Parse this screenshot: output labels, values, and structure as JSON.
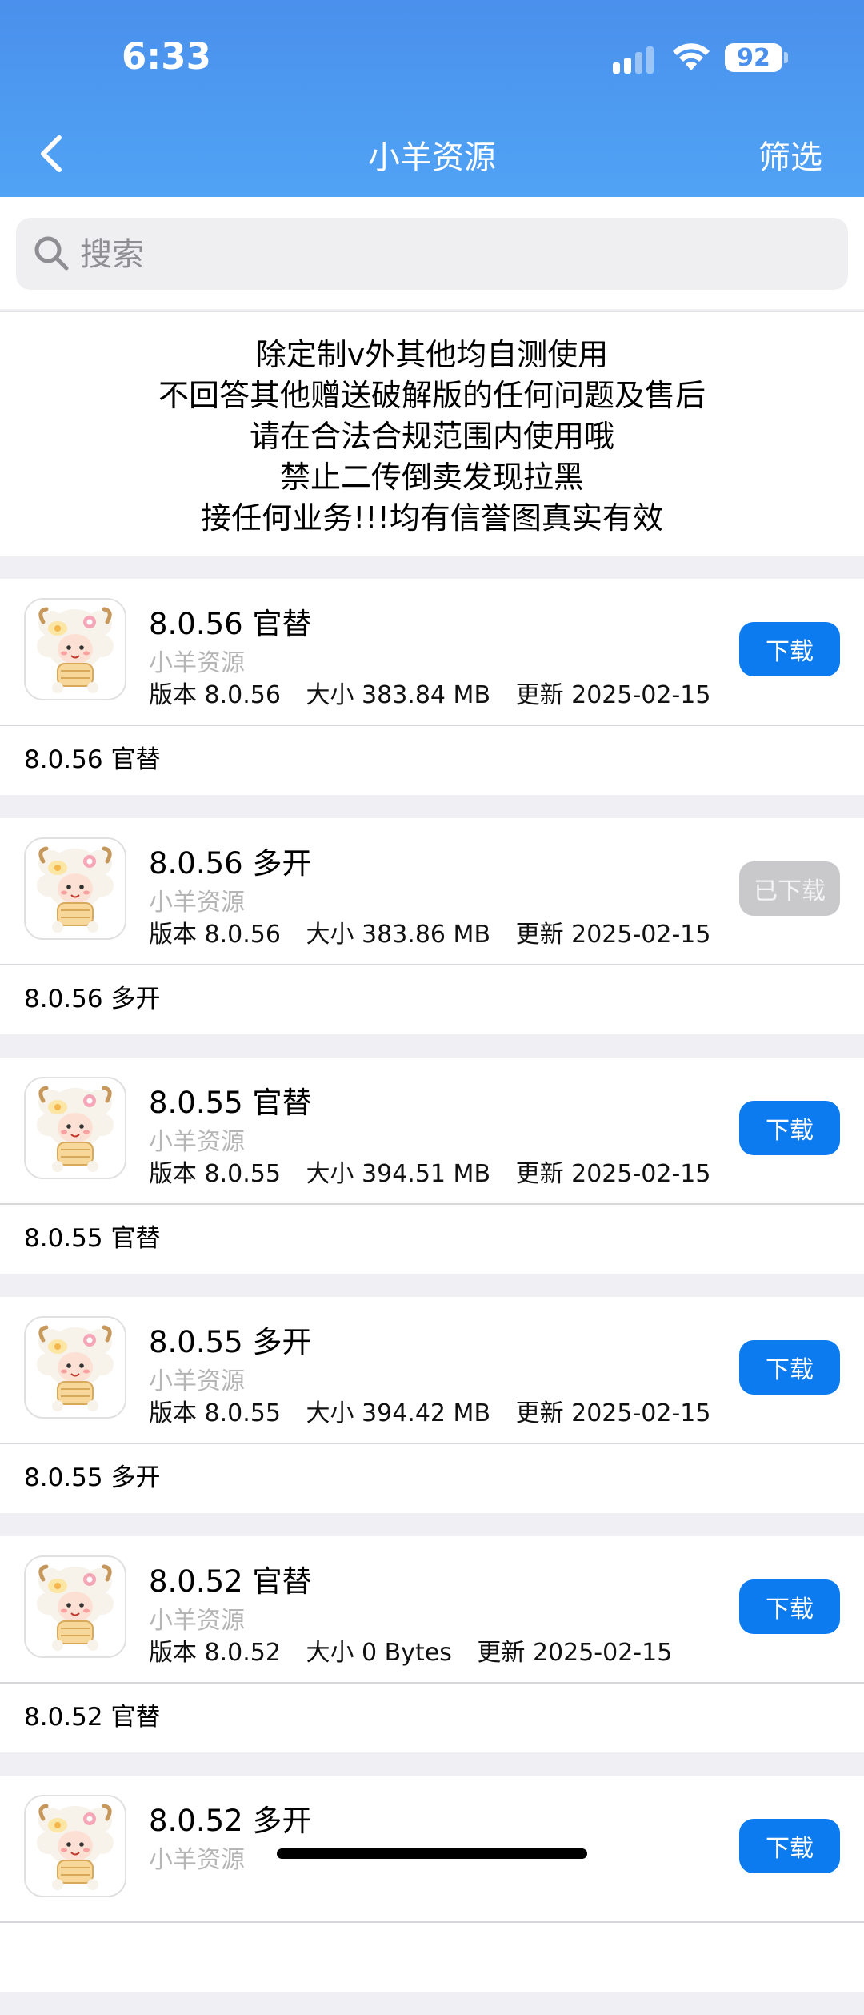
{
  "status": {
    "time": "6:33",
    "battery": "92"
  },
  "nav": {
    "title": "小羊资源",
    "filter": "筛选"
  },
  "search": {
    "placeholder": "搜索"
  },
  "notice": {
    "lines": [
      "除定制v外其他均自测使用",
      "不回答其他赠送破解版的任何问题及售后",
      "请在合法合规范围内使用哦",
      "禁止二传倒卖发现拉黑",
      "接任何业务!!!均有信誉图真实有效"
    ]
  },
  "apps": [
    {
      "title": "8.0.56 官替",
      "source": "小羊资源",
      "version": "版本 8.0.56",
      "size": "大小 383.84 MB",
      "updated": "更新 2025-02-15",
      "button": "下载",
      "downloaded": false,
      "desc": "8.0.56 官替"
    },
    {
      "title": "8.0.56 多开",
      "source": "小羊资源",
      "version": "版本 8.0.56",
      "size": "大小 383.86 MB",
      "updated": "更新 2025-02-15",
      "button": "已下载",
      "downloaded": true,
      "desc": "8.0.56 多开"
    },
    {
      "title": "8.0.55 官替",
      "source": "小羊资源",
      "version": "版本 8.0.55",
      "size": "大小 394.51 MB",
      "updated": "更新 2025-02-15",
      "button": "下载",
      "downloaded": false,
      "desc": "8.0.55 官替"
    },
    {
      "title": "8.0.55 多开",
      "source": "小羊资源",
      "version": "版本 8.0.55",
      "size": "大小 394.42 MB",
      "updated": "更新 2025-02-15",
      "button": "下载",
      "downloaded": false,
      "desc": "8.0.55 多开"
    },
    {
      "title": "8.0.52 官替",
      "source": "小羊资源",
      "version": "版本 8.0.52",
      "size": "大小 0 Bytes",
      "updated": "更新 2025-02-15",
      "button": "下载",
      "downloaded": false,
      "desc": "8.0.52 官替"
    },
    {
      "title": "8.0.52 多开",
      "source": "小羊资源",
      "version": "",
      "size": "",
      "updated": "",
      "button": "下载",
      "downloaded": false,
      "desc": ""
    }
  ],
  "colors": {
    "header": "#4a90ec",
    "button": "#0c7bf0",
    "button_done": "#c9c9cc"
  }
}
